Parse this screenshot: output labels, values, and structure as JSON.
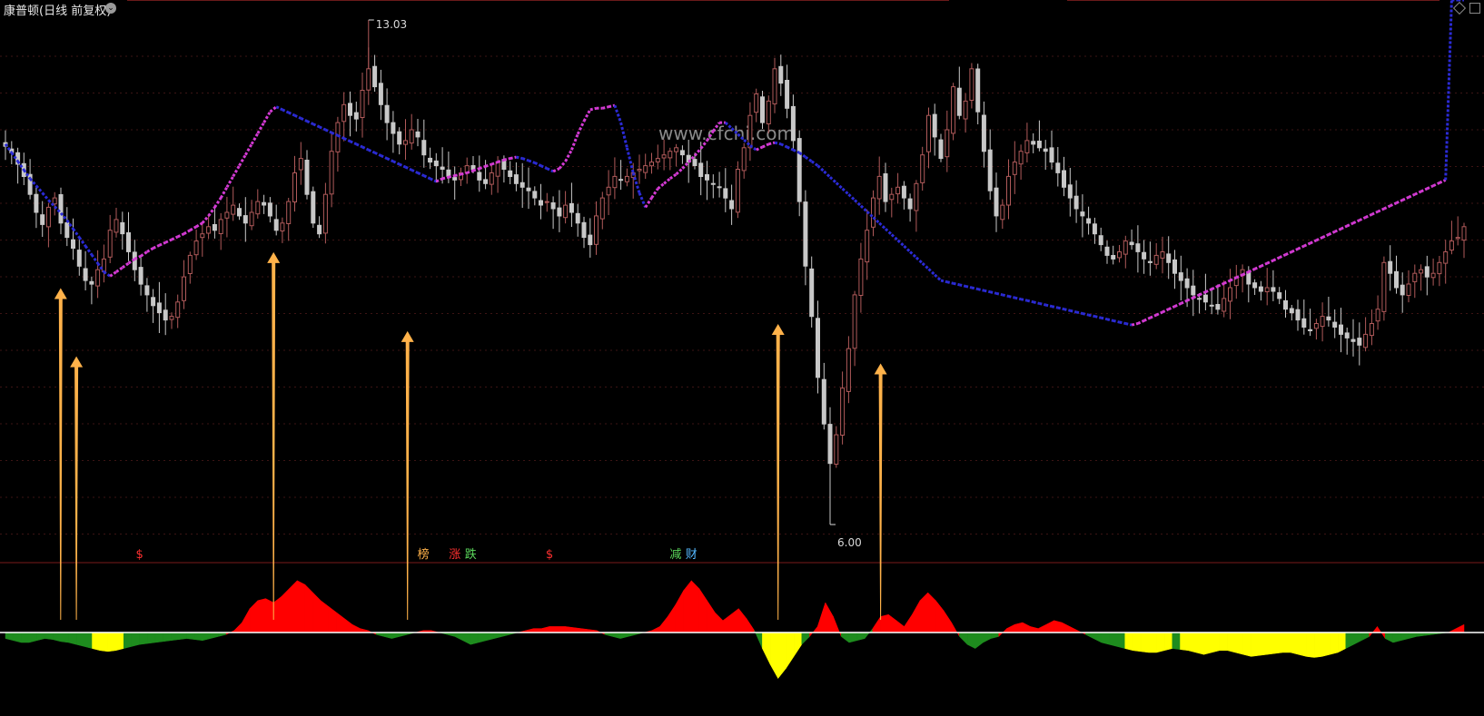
{
  "header": {
    "title": "康普顿(日线 前复权)",
    "menu_icon": "chevron-down-icon",
    "right_icons": [
      "diamond-icon",
      "window-icon"
    ]
  },
  "watermark": "www.cfchi.com",
  "colors": {
    "background": "#000000",
    "up": "#b05a5a",
    "down": "#c8c8c8",
    "ma_down": "#2b2bd6",
    "ma_up": "#d43ad4",
    "arrow": "#ffb24a",
    "osc_red": "#ff0000",
    "osc_green": "#1e8c1e",
    "osc_yellow": "#ffff00",
    "baseline": "#ffffff"
  },
  "chart_data": {
    "type": "candlestick",
    "price_max_label": "13.03",
    "price_min_label": "6.00",
    "close": [
      11.27,
      11.18,
      11.02,
      10.85,
      10.6,
      10.35,
      10.18,
      10.42,
      10.55,
      10.2,
      10.0,
      9.85,
      9.6,
      9.4,
      9.35,
      9.55,
      9.7,
      10.1,
      10.25,
      10.05,
      9.8,
      9.55,
      9.35,
      9.2,
      9.05,
      8.95,
      8.85,
      8.9,
      9.1,
      9.45,
      9.75,
      9.95,
      10.05,
      10.15,
      10.1,
      10.25,
      10.35,
      10.45,
      10.3,
      10.2,
      10.35,
      10.5,
      10.45,
      10.3,
      10.1,
      10.2,
      10.5,
      10.9,
      11.1,
      10.6,
      10.2,
      10.05,
      10.6,
      11.2,
      11.6,
      11.85,
      11.7,
      11.65,
      12.05,
      12.35,
      12.1,
      11.85,
      11.6,
      11.45,
      11.3,
      11.35,
      11.5,
      11.4,
      11.15,
      11.05,
      11.0,
      10.95,
      10.85,
      10.8,
      10.9,
      11.0,
      10.95,
      10.8,
      10.75,
      10.9,
      11.05,
      10.95,
      10.85,
      10.75,
      10.7,
      10.65,
      10.55,
      10.45,
      10.5,
      10.4,
      10.3,
      10.45,
      10.35,
      10.2,
      10.0,
      9.9,
      10.3,
      10.55,
      10.7,
      10.85,
      10.8,
      10.85,
      10.9,
      10.95,
      11.0,
      11.05,
      11.1,
      11.15,
      11.2,
      11.25,
      11.15,
      11.05,
      11.0,
      10.85,
      10.8,
      10.75,
      10.7,
      10.55,
      10.4,
      10.95,
      11.25,
      11.7,
      12.0,
      11.6,
      11.9,
      12.35,
      12.15,
      11.8,
      11.35,
      10.5,
      9.6,
      8.9,
      8.05,
      7.4,
      6.85,
      7.25,
      7.9,
      8.45,
      9.2,
      9.7,
      10.1,
      10.55,
      10.85,
      10.5,
      10.6,
      10.7,
      10.55,
      10.4,
      10.75,
      11.15,
      11.7,
      11.4,
      11.1,
      11.5,
      12.1,
      11.7,
      11.9,
      12.35,
      11.75,
      11.2,
      10.65,
      10.3,
      10.45,
      10.85,
      11.05,
      11.2,
      11.35,
      11.3,
      11.25,
      11.2,
      11.05,
      10.9,
      10.7,
      10.55,
      10.4,
      10.3,
      10.2,
      10.05,
      9.9,
      9.75,
      9.7,
      9.8,
      9.95,
      9.9,
      9.8,
      9.7,
      9.65,
      9.75,
      9.8,
      9.65,
      9.5,
      9.4,
      9.3,
      9.2,
      9.15,
      9.1,
      9.05,
      9.0,
      9.15,
      9.3,
      9.45,
      9.55,
      9.35,
      9.3,
      9.25,
      9.3,
      9.25,
      9.15,
      9.0,
      8.95,
      8.85,
      8.75,
      8.7,
      8.8,
      8.9,
      8.85,
      8.75,
      8.65,
      8.6,
      8.55,
      8.5,
      8.65,
      8.8,
      9.0,
      9.65,
      9.5,
      9.3,
      9.2,
      9.35,
      9.5,
      9.55,
      9.45,
      9.5,
      9.65,
      9.8,
      9.95,
      10.0,
      10.15
    ],
    "ma": [
      11.3,
      11.18,
      11.06,
      10.94,
      10.82,
      10.72,
      10.62,
      10.52,
      10.43,
      10.34,
      10.24,
      10.12,
      10.0,
      9.88,
      9.76,
      9.64,
      9.52,
      9.46,
      9.52,
      9.58,
      9.64,
      9.7,
      9.74,
      9.8,
      9.85,
      9.89,
      9.93,
      9.97,
      10.01,
      10.05,
      10.1,
      10.15,
      10.2,
      10.3,
      10.42,
      10.55,
      10.7,
      10.85,
      11.0,
      11.15,
      11.3,
      11.45,
      11.6,
      11.75,
      11.82,
      11.78,
      11.74,
      11.7,
      11.66,
      11.62,
      11.58,
      11.54,
      11.5,
      11.46,
      11.42,
      11.38,
      11.34,
      11.3,
      11.26,
      11.22,
      11.18,
      11.14,
      11.1,
      11.06,
      11.02,
      10.98,
      10.94,
      10.9,
      10.86,
      10.82,
      10.78,
      10.82,
      10.84,
      10.86,
      10.88,
      10.9,
      10.93,
      10.96,
      10.99,
      11.02,
      11.05,
      11.08,
      11.1,
      11.12,
      11.1,
      11.07,
      11.04,
      11.0,
      10.96,
      10.92,
      10.96,
      11.06,
      11.22,
      11.44,
      11.62,
      11.78,
      11.8,
      11.8,
      11.82,
      11.84,
      11.6,
      11.25,
      10.9,
      10.62,
      10.42,
      10.55,
      10.68,
      10.75,
      10.82,
      10.88,
      10.96,
      11.05,
      11.14,
      11.24,
      11.35,
      11.48,
      11.6,
      11.6,
      11.52,
      11.44,
      11.36,
      11.28,
      11.22,
      11.26,
      11.3,
      11.32,
      11.3,
      11.26,
      11.22,
      11.18,
      11.12,
      11.06,
      11.0,
      10.92,
      10.84,
      10.76,
      10.68,
      10.6,
      10.52,
      10.44,
      10.36,
      10.28,
      10.2,
      10.12,
      10.04,
      9.96,
      9.88,
      9.8,
      9.72,
      9.64,
      9.56,
      9.48,
      9.4,
      9.38,
      9.36,
      9.34,
      9.32,
      9.3,
      9.28,
      9.26,
      9.24,
      9.22,
      9.2,
      9.18,
      9.16,
      9.14,
      9.12,
      9.1,
      9.08,
      9.06,
      9.04,
      9.02,
      9.0,
      8.98,
      8.96,
      8.94,
      8.92,
      8.9,
      8.88,
      8.86,
      8.84,
      8.82,
      8.8,
      8.78,
      8.8,
      8.84,
      8.88,
      8.92,
      8.96,
      9.0,
      9.04,
      9.08,
      9.12,
      9.16,
      9.2,
      9.24,
      9.28,
      9.32,
      9.36,
      9.4,
      9.44,
      9.48,
      9.52,
      9.56,
      9.6,
      9.64,
      9.68,
      9.72,
      9.76,
      9.8,
      9.84,
      9.88,
      9.92,
      9.96,
      10.0,
      10.04,
      10.08,
      10.12,
      10.16,
      10.2,
      10.24,
      10.28,
      10.32,
      10.36,
      10.4,
      10.44,
      10.48,
      10.52,
      10.56,
      10.6,
      10.64,
      10.68,
      10.72,
      10.76,
      10.8
    ],
    "oscillator": [
      -0.3,
      -0.4,
      -0.5,
      -0.5,
      -0.4,
      -0.3,
      -0.35,
      -0.45,
      -0.5,
      -0.6,
      -0.7,
      -0.8,
      -0.9,
      -0.95,
      -0.9,
      -0.8,
      -0.7,
      -0.6,
      -0.55,
      -0.5,
      -0.45,
      -0.4,
      -0.35,
      -0.3,
      -0.35,
      -0.4,
      -0.3,
      -0.2,
      -0.1,
      0.1,
      0.5,
      1.2,
      1.6,
      1.7,
      1.5,
      1.8,
      2.2,
      2.6,
      2.4,
      2.0,
      1.6,
      1.3,
      1.0,
      0.7,
      0.4,
      0.2,
      0.1,
      -0.1,
      -0.2,
      -0.3,
      -0.2,
      -0.1,
      0.0,
      0.1,
      0.1,
      0.0,
      -0.1,
      -0.2,
      -0.4,
      -0.6,
      -0.5,
      -0.4,
      -0.3,
      -0.2,
      -0.1,
      0.0,
      0.1,
      0.2,
      0.2,
      0.3,
      0.3,
      0.3,
      0.25,
      0.2,
      0.15,
      0.1,
      -0.1,
      -0.2,
      -0.3,
      -0.2,
      -0.1,
      0.0,
      0.1,
      0.3,
      0.8,
      1.4,
      2.1,
      2.6,
      2.2,
      1.6,
      1.0,
      0.6,
      0.9,
      1.2,
      0.7,
      0.1,
      -0.8,
      -1.6,
      -2.3,
      -1.8,
      -1.2,
      -0.6,
      -0.2,
      0.3,
      1.5,
      0.8,
      -0.2,
      -0.5,
      -0.4,
      -0.3,
      0.2,
      0.8,
      0.9,
      0.6,
      0.3,
      0.9,
      1.6,
      2.0,
      1.6,
      1.1,
      0.5,
      -0.2,
      -0.6,
      -0.8,
      -0.5,
      -0.3,
      -0.2,
      0.2,
      0.4,
      0.5,
      0.3,
      0.2,
      0.4,
      0.6,
      0.5,
      0.3,
      0.1,
      -0.1,
      -0.3,
      -0.5,
      -0.6,
      -0.7,
      -0.8,
      -0.9,
      -0.95,
      -1.0,
      -1.0,
      -0.9,
      -0.8,
      -0.85,
      -0.9,
      -1.0,
      -1.1,
      -1.0,
      -0.9,
      -0.9,
      -1.0,
      -1.1,
      -1.2,
      -1.15,
      -1.1,
      -1.05,
      -1.0,
      -1.0,
      -1.1,
      -1.2,
      -1.25,
      -1.2,
      -1.1,
      -1.0,
      -0.8,
      -0.6,
      -0.4,
      -0.2,
      0.3,
      -0.3,
      -0.5,
      -0.4,
      -0.3,
      -0.2,
      -0.15,
      -0.1,
      -0.05,
      0.0,
      0.2,
      0.4
    ],
    "arrows_at_index": [
      7,
      9,
      34,
      51,
      98,
      111
    ],
    "markers": [
      {
        "index": 17,
        "text": "$",
        "color": "#ff3030"
      },
      {
        "index": 53,
        "text": "榜",
        "color": "#ffb24a"
      },
      {
        "index": 57,
        "text": "涨",
        "color": "#ff3030"
      },
      {
        "index": 59,
        "text": "跌",
        "color": "#5bd75b"
      },
      {
        "index": 69,
        "text": "$",
        "color": "#ff3030"
      },
      {
        "index": 85,
        "text": "减",
        "color": "#5bd75b"
      },
      {
        "index": 87,
        "text": "财",
        "color": "#55b8ff"
      }
    ]
  }
}
